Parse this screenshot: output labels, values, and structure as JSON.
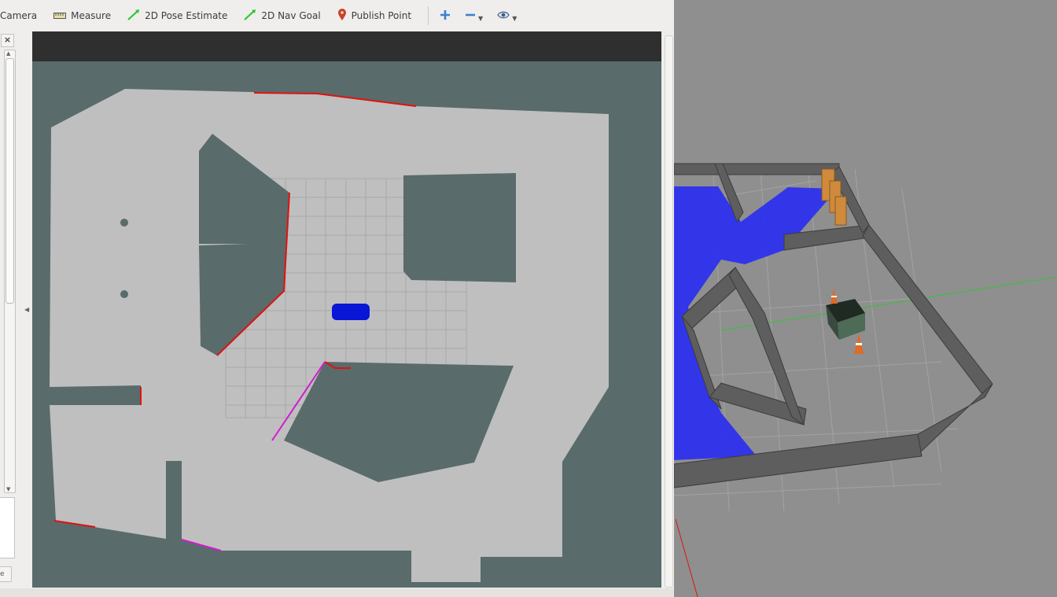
{
  "toolbar": {
    "tools": [
      {
        "name": "camera",
        "label": "Camera",
        "icon": "camera-icon"
      },
      {
        "name": "measure",
        "label": "Measure",
        "icon": "ruler-icon"
      },
      {
        "name": "pose-estimate",
        "label": "2D Pose Estimate",
        "icon": "green-arrow-icon"
      },
      {
        "name": "nav-goal",
        "label": "2D Nav Goal",
        "icon": "green-arrow-icon"
      },
      {
        "name": "publish-point",
        "label": "Publish Point",
        "icon": "map-pin-icon"
      }
    ],
    "view_buttons": [
      {
        "name": "add-tool",
        "icon": "plus-icon"
      },
      {
        "name": "remove-tool",
        "icon": "minus-icon"
      },
      {
        "name": "view-options",
        "icon": "eye-icon"
      }
    ]
  },
  "left_panel": {
    "close_label": "×",
    "mini_button_label": "e"
  },
  "colors": {
    "map_unknown": "#596b6a",
    "map_free": "#bfbfbf",
    "map_grid": "#a9a9a9",
    "laser_scan": "#e0120f",
    "robot_footprint": "#0a16d6",
    "gazebo_ground": "#8f8f8f",
    "gazebo_laser": "#2a2ff0"
  }
}
